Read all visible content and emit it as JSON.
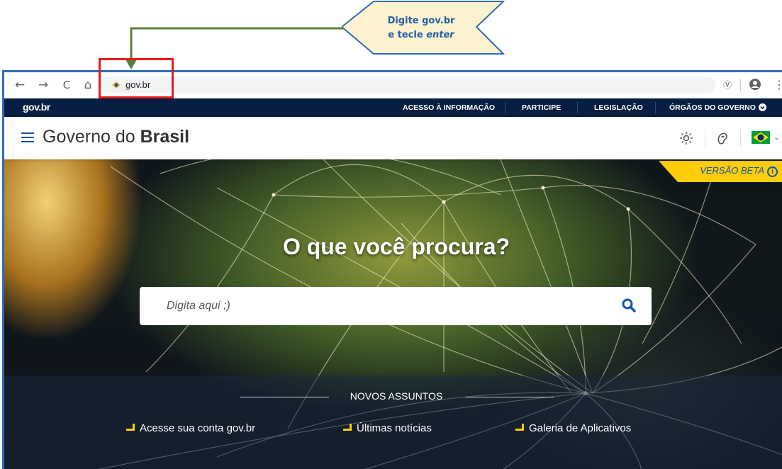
{
  "callout": {
    "line1": "Digite gov.br",
    "line2_prefix": "e tecle ",
    "line2_em": "enter"
  },
  "browser": {
    "url": "gov.br",
    "nav": {
      "back": "←",
      "forward": "→",
      "reload": "C",
      "home": "⌂"
    }
  },
  "govbar": {
    "logo": "gov.br",
    "links": [
      "ACESSO À INFORMAÇÃO",
      "PARTICIPE",
      "LEGISLAÇÃO",
      "ÓRGÃOS DO GOVERNO"
    ]
  },
  "header": {
    "title_prefix": "Governo do ",
    "title_bold": "Brasil"
  },
  "hero": {
    "beta_label": "VERSÃO BETA",
    "title": "O que você procura?",
    "search_placeholder": "Digita aqui ;)"
  },
  "topics": {
    "title": "NOVOS ASSUNTOS",
    "items": [
      "Acesse sua conta gov.br",
      "Últimas notícias",
      "Galeria de Aplicativos"
    ]
  },
  "colors": {
    "govbar": "#071d41",
    "accent_blue": "#1351b4",
    "accent_yellow": "#ffcd07",
    "highlight_red": "#e41b1b",
    "callout_fill": "#fdf2d0"
  },
  "icons": [
    "menu-icon",
    "contrast-icon",
    "sign-language-icon",
    "brazil-flag-icon",
    "search-icon",
    "info-icon",
    "account-icon"
  ]
}
